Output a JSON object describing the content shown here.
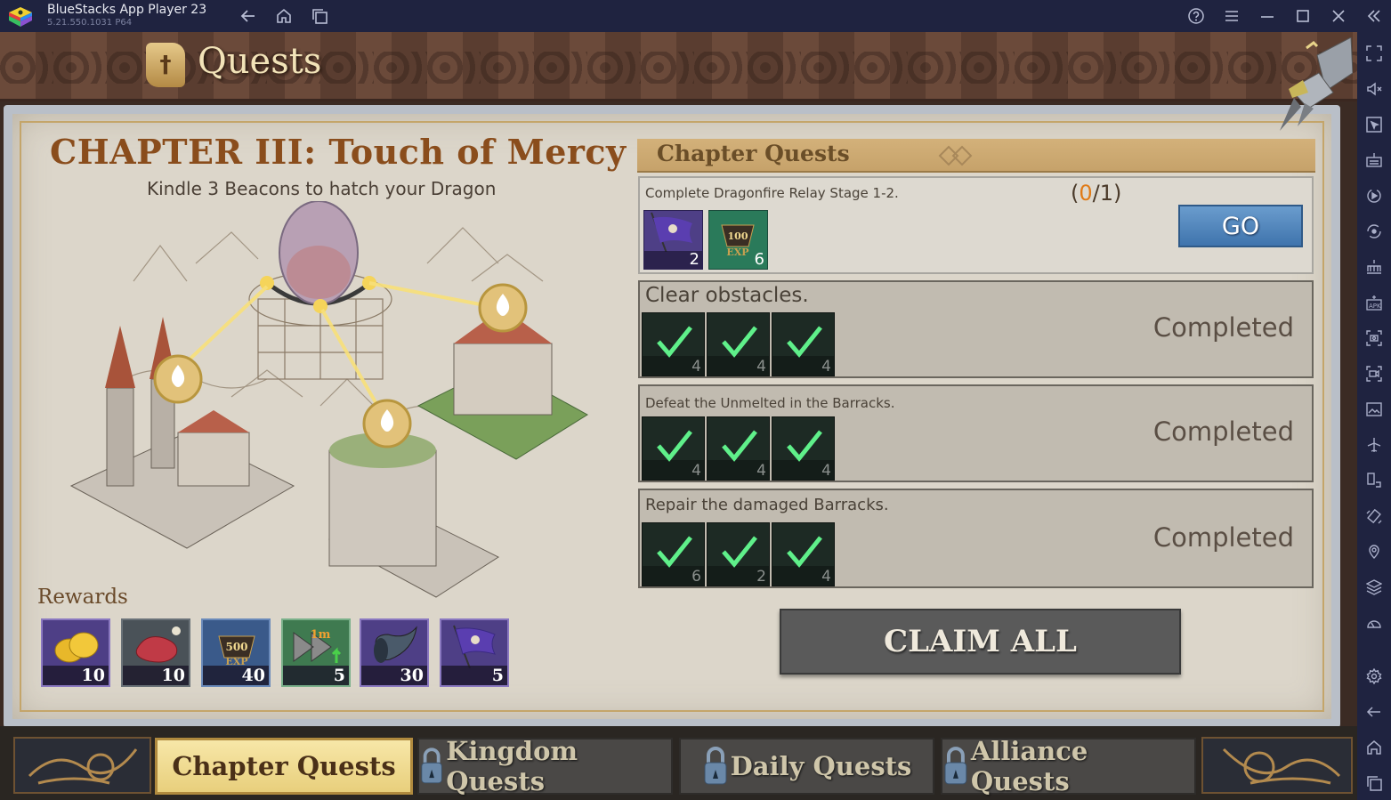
{
  "window": {
    "app_title": "BlueStacks App Player 23",
    "version": "5.21.550.1031  P64",
    "nav_icons": [
      "back-icon",
      "home-icon",
      "recent-apps-icon"
    ],
    "controls": [
      "help-icon",
      "menu-icon",
      "minimize-icon",
      "maximize-icon",
      "close-icon",
      "collapse-sidebar-icon"
    ]
  },
  "sidebar": {
    "tools": [
      "fullscreen",
      "volume-mute",
      "pointer",
      "keyboard-controls",
      "macro-play",
      "sync",
      "game-controls",
      "install-apk",
      "screenshot",
      "record-video",
      "media-folder",
      "airplane-mode",
      "rotate",
      "shake",
      "location",
      "multi-instance",
      "performance",
      "settings",
      "back",
      "home",
      "recent-apps"
    ]
  },
  "header": {
    "title": "Quests",
    "close_label": "close"
  },
  "chapter": {
    "title": "CHAPTER III: Touch of Mercy",
    "subtitle": "Kindle 3 Beacons to hatch your Dragon",
    "beacons_lit": 3,
    "beacons_total": 3
  },
  "rewards": {
    "label": "Rewards",
    "items": [
      {
        "name": "gold-coins",
        "count": "10",
        "frame": "#4e3f86"
      },
      {
        "name": "meat",
        "count": "10",
        "frame": "#4a5258"
      },
      {
        "name": "exp-500",
        "count": "40",
        "frame": "#3a5a8a",
        "badge": "500",
        "badge_sub": "EXP"
      },
      {
        "name": "speedup-1m",
        "count": "5",
        "frame": "#3f7a50",
        "badge": "1m"
      },
      {
        "name": "war-horn",
        "count": "30",
        "frame": "#4e3f86"
      },
      {
        "name": "purple-banner",
        "count": "5",
        "frame": "#4e3f86"
      }
    ]
  },
  "chapter_quests": {
    "header": "Chapter Quests",
    "quests": [
      {
        "text": "Complete Dragonfire Relay Stage 1-2.",
        "progress_current": "0",
        "progress_total": "1",
        "progress_open": "(",
        "progress_sep": "/",
        "progress_close": ")",
        "action": "GO",
        "rewards": [
          {
            "name": "purple-banner",
            "count": "2"
          },
          {
            "name": "exp-100",
            "count": "6",
            "badge": "100",
            "badge_sub": "EXP"
          }
        ]
      },
      {
        "text": "Clear obstacles.",
        "status": "Completed",
        "rewards": [
          {
            "name": "speedup",
            "count": "4"
          },
          {
            "name": "speedup",
            "count": "4"
          },
          {
            "name": "speedup",
            "count": "4"
          }
        ]
      },
      {
        "text": "Defeat the Unmelted in the Barracks.",
        "status": "Completed",
        "rewards": [
          {
            "name": "speedup",
            "count": "4"
          },
          {
            "name": "speedup",
            "count": "4"
          },
          {
            "name": "speedup",
            "count": "4"
          }
        ]
      },
      {
        "text": "Repair the damaged Barracks.",
        "status": "Completed",
        "rewards": [
          {
            "name": "speedup",
            "count": "6"
          },
          {
            "name": "speedup",
            "count": "2"
          },
          {
            "name": "speedup",
            "count": "4"
          }
        ]
      }
    ],
    "claim_all": "CLAIM ALL"
  },
  "tabs": [
    {
      "label": "Chapter Quests",
      "active": true,
      "locked": false
    },
    {
      "label": "Kingdom Quests",
      "active": false,
      "locked": true
    },
    {
      "label": "Daily Quests",
      "active": false,
      "locked": true
    },
    {
      "label": "Alliance Quests",
      "active": false,
      "locked": true
    }
  ],
  "colors": {
    "accent_orange": "#e07a16",
    "go_blue": "#4f86bf",
    "completed_check": "#5ff08a",
    "chapter_title": "#8a4d1c"
  }
}
